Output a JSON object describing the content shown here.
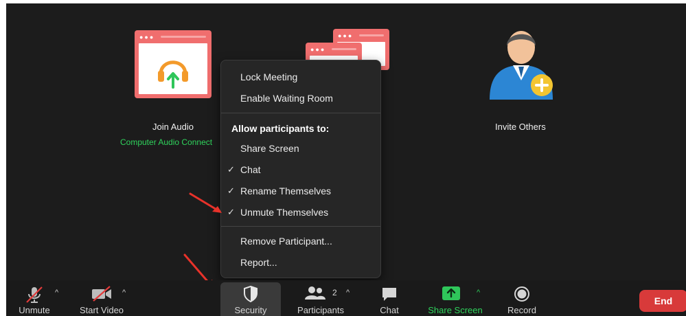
{
  "tiles": {
    "join_audio": {
      "title": "Join Audio",
      "subtitle": "Computer Audio Connect"
    },
    "invite": {
      "title": "Invite Others"
    }
  },
  "security_menu": {
    "items_top": [
      "Lock Meeting",
      "Enable Waiting Room"
    ],
    "section_heading": "Allow participants to:",
    "permissions": [
      {
        "label": "Share Screen",
        "checked": false
      },
      {
        "label": "Chat",
        "checked": true
      },
      {
        "label": "Rename Themselves",
        "checked": true
      },
      {
        "label": "Unmute Themselves",
        "checked": true
      }
    ],
    "items_bottom": [
      "Remove Participant...",
      "Report..."
    ],
    "check_glyph": "✓"
  },
  "toolbar": {
    "unmute": "Unmute",
    "start_video": "Start Video",
    "security": "Security",
    "participants": "Participants",
    "participant_count": "2",
    "chat": "Chat",
    "share_screen": "Share Screen",
    "record": "Record",
    "end": "End",
    "caret_glyph": "^"
  },
  "colors": {
    "accent_green": "#2fd35c",
    "end_red": "#d83a3a",
    "tile_red": "#f06e6e",
    "arrow_red": "#e8322a"
  },
  "icons": {
    "unmute": "microphone-muted-icon",
    "start_video": "camera-off-icon",
    "security": "shield-icon",
    "participants": "people-icon",
    "chat": "chat-bubble-icon",
    "share_screen": "share-screen-icon",
    "record": "record-icon"
  }
}
